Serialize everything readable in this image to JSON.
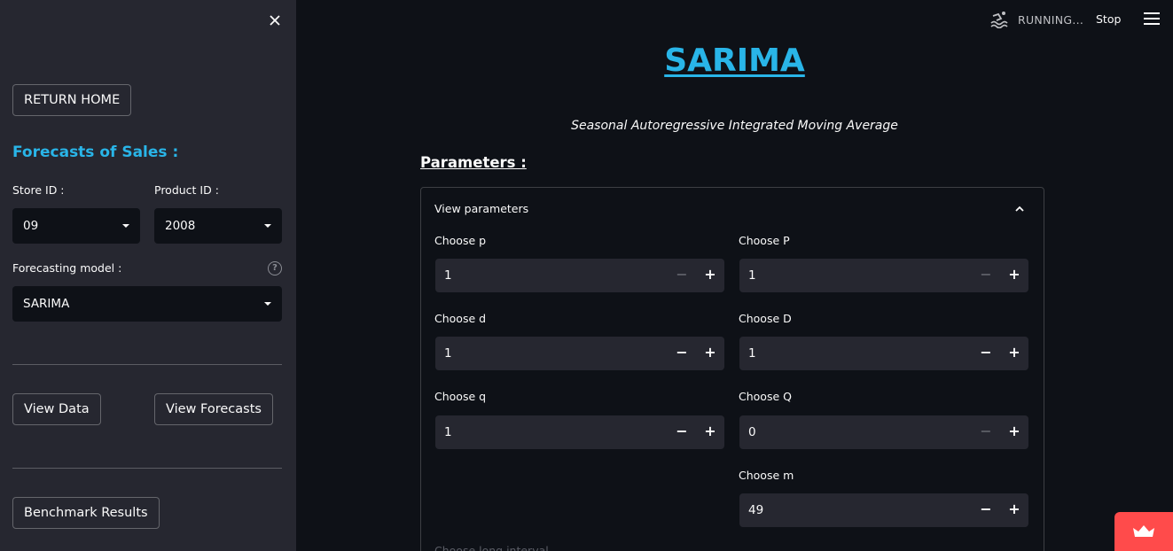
{
  "sidebar": {
    "return_home": "RETURN HOME",
    "heading": "Forecasts of Sales :",
    "store_label": "Store ID :",
    "store_value": "09",
    "product_label": "Product ID :",
    "product_value": "2008",
    "model_label": "Forecasting model :",
    "model_value": "SARIMA",
    "help_symbol": "?",
    "view_data": "View Data",
    "view_forecasts": "View Forecasts",
    "benchmark": "Benchmark Results"
  },
  "header": {
    "status": "RUNNING...",
    "stop": "Stop"
  },
  "main": {
    "title": "SARIMA",
    "subtitle": "Seasonal Autoregressive Integrated Moving Average",
    "params_heading": "Parameters :",
    "expander_label": "View parameters",
    "fields": {
      "p": {
        "label": "Choose p",
        "value": "1"
      },
      "P": {
        "label": "Choose P",
        "value": "1"
      },
      "d": {
        "label": "Choose d",
        "value": "1"
      },
      "D": {
        "label": "Choose D",
        "value": "1"
      },
      "q": {
        "label": "Choose q",
        "value": "1"
      },
      "Q": {
        "label": "Choose Q",
        "value": "0"
      },
      "m": {
        "label": "Choose m",
        "value": "49"
      }
    },
    "minus_symbol": "−",
    "plus_symbol": "+",
    "cut_label": "Choose long interval"
  },
  "colors": {
    "accent": "#29b5e8",
    "sidebar_bg": "#262730",
    "main_bg": "#0e1117",
    "badge": "#ff4b4b"
  }
}
